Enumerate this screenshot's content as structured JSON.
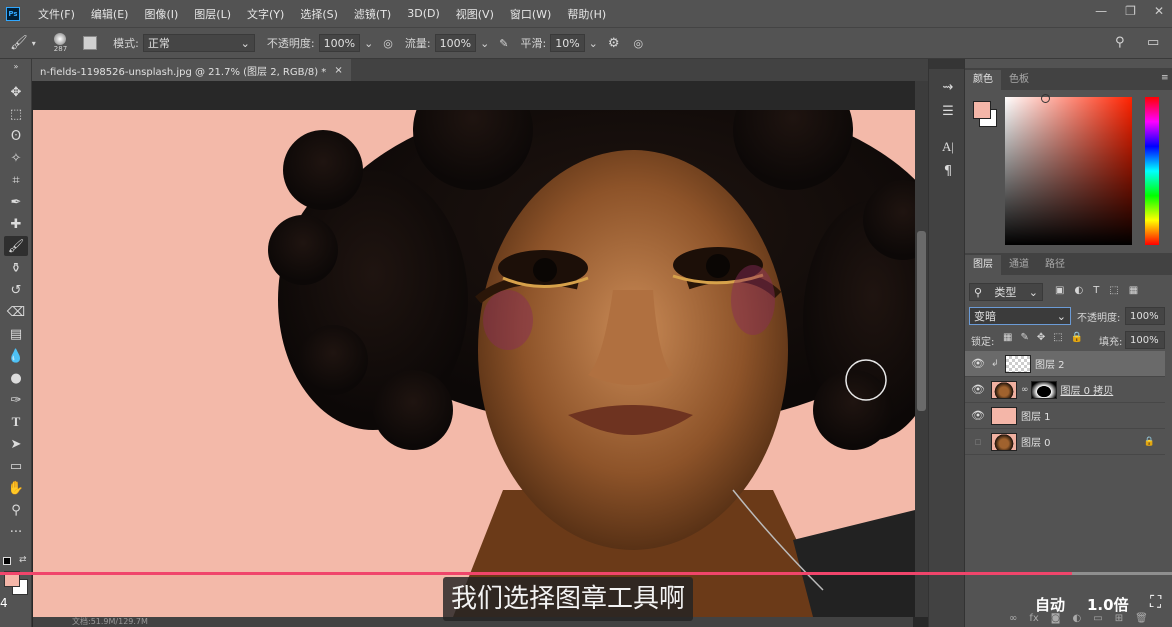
{
  "app": {
    "logo": "Ps"
  },
  "menu": [
    "文件(F)",
    "编辑(E)",
    "图像(I)",
    "图层(L)",
    "文字(Y)",
    "选择(S)",
    "滤镜(T)",
    "3D(D)",
    "视图(V)",
    "窗口(W)",
    "帮助(H)"
  ],
  "window_buttons": [
    "—",
    "❐",
    "✕"
  ],
  "options": {
    "brush_size": "287",
    "mode_label": "模式:",
    "mode_value": "正常",
    "opacity_label": "不透明度:",
    "opacity_value": "100%",
    "flow_label": "流量:",
    "flow_value": "100%",
    "smooth_label": "平滑:",
    "smooth_value": "10%"
  },
  "document_tab": {
    "title": "n-fields-1198526-unsplash.jpg @ 21.7% (图层 2, RGB/8) *",
    "close": "×"
  },
  "status": {
    "doc_info": "文档:51.9M/129.7M"
  },
  "color_panel": {
    "tabs": [
      "颜色",
      "色板"
    ],
    "foreground": "#f4b6a8",
    "background": "#ffffff"
  },
  "layers_panel": {
    "tabs": [
      "图层",
      "通道",
      "路径"
    ],
    "filter_kind": "类型",
    "blend_mode": "变暗",
    "opacity_label": "不透明度:",
    "opacity_value": "100%",
    "lock_label": "锁定:",
    "fill_label": "填充:",
    "fill_value": "100%",
    "layers": [
      {
        "name": "图层 2",
        "visible": true,
        "selected": true
      },
      {
        "name": "图层 0 拷贝",
        "visible": true,
        "selected": false
      },
      {
        "name": "图层 1",
        "visible": true,
        "selected": false
      },
      {
        "name": "图层 0",
        "visible": false,
        "selected": false
      }
    ]
  },
  "video": {
    "subtitle": "我们选择图章工具啊",
    "auto_label": "自动",
    "speed_label": "1.0倍",
    "progress": 0.915,
    "accent": "#f0456b",
    "page_indicator": "4"
  }
}
